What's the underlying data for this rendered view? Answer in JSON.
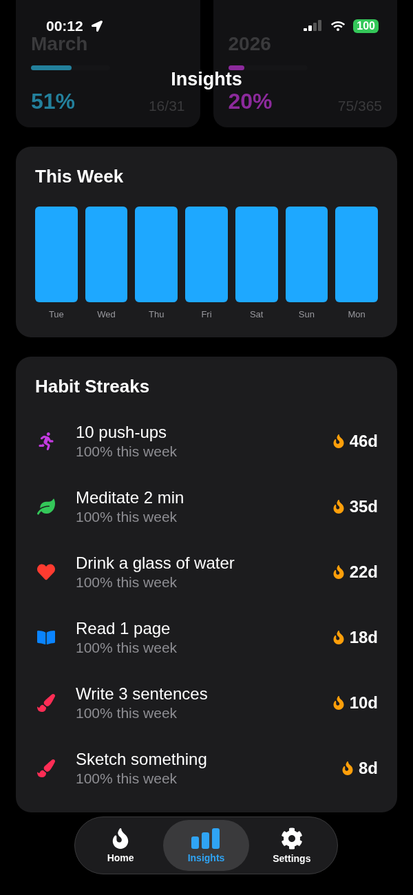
{
  "status_bar": {
    "time": "00:12",
    "battery": "100"
  },
  "summary_cards": [
    {
      "period": "March",
      "percent": "51%",
      "count": "16/31",
      "level": 0.51,
      "color": "#23809c"
    },
    {
      "period": "2026",
      "percent": "20%",
      "count": "75/365",
      "level": 0.2,
      "color": "#8c2a9c"
    }
  ],
  "title": "Insights",
  "this_week": {
    "title": "This Week",
    "days": [
      {
        "label": "Tue"
      },
      {
        "label": "Wed"
      },
      {
        "label": "Thu"
      },
      {
        "label": "Fri"
      },
      {
        "label": "Sat"
      },
      {
        "label": "Sun"
      },
      {
        "label": "Mon"
      }
    ]
  },
  "habit_streaks": {
    "title": "Habit Streaks",
    "habits": [
      {
        "kind": "run",
        "color": "#c33be0",
        "name": "10 push-ups",
        "progress": "100% this week",
        "streak": "46d"
      },
      {
        "kind": "leaf",
        "color": "#34c759",
        "name": "Meditate 2 min",
        "progress": "100% this week",
        "streak": "35d"
      },
      {
        "kind": "heart",
        "color": "#ff3b30",
        "name": "Drink a glass of water",
        "progress": "100% this week",
        "streak": "22d"
      },
      {
        "kind": "book",
        "color": "#0a84ff",
        "name": "Read 1 page",
        "progress": "100% this week",
        "streak": "18d"
      },
      {
        "kind": "brush",
        "color": "#ff2d55",
        "name": "Write 3 sentences",
        "progress": "100% this week",
        "streak": "10d"
      },
      {
        "kind": "brush",
        "color": "#ff2d55",
        "name": "Sketch something",
        "progress": "100% this week",
        "streak": "8d"
      }
    ]
  },
  "tabs": [
    {
      "kind": "home",
      "label": "Home",
      "selected": false
    },
    {
      "kind": "insights",
      "label": "Insights",
      "selected": true
    },
    {
      "kind": "settings",
      "label": "Settings",
      "selected": false
    }
  ]
}
